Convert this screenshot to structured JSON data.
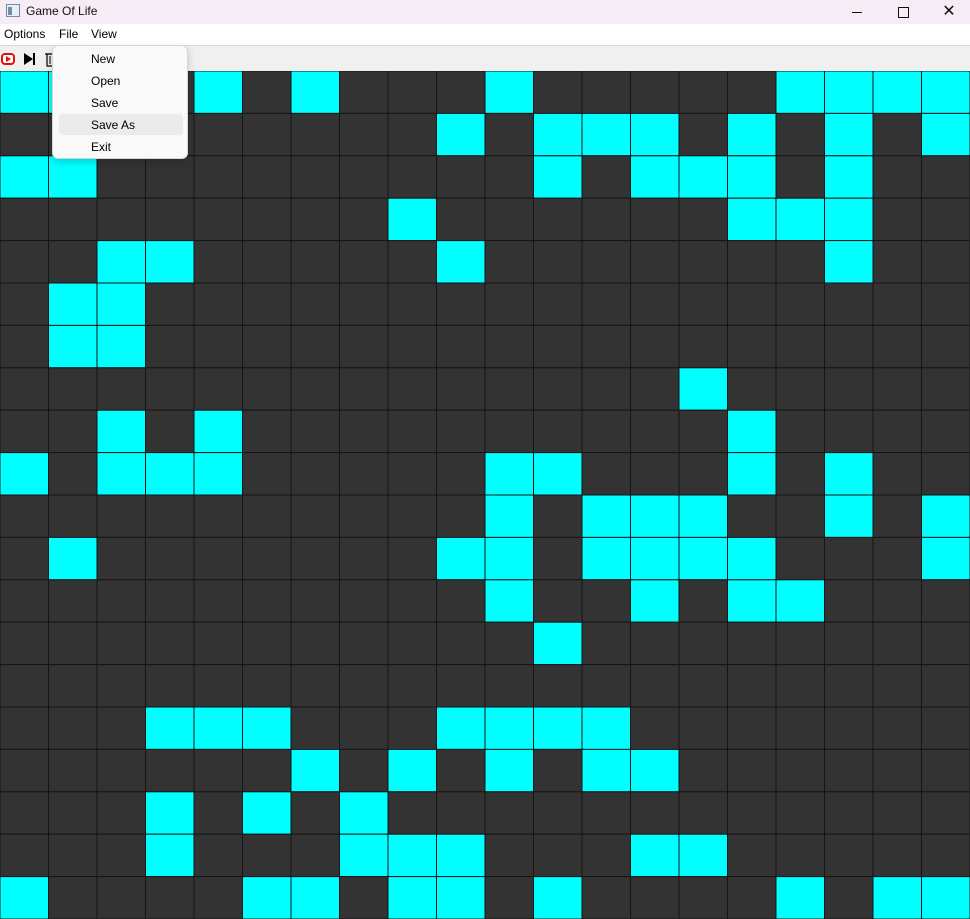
{
  "window": {
    "title": "Game Of Life",
    "icon": "app-window-icon",
    "controls": {
      "minimize": "minimize-icon",
      "maximize": "maximize-icon",
      "close": "close-icon",
      "close_glyph": "✕"
    }
  },
  "menubar": {
    "options_label": "Options",
    "file_label": "File",
    "view_label": "View"
  },
  "toolbar": {
    "buttons": [
      "play-icon",
      "step-icon",
      "clear-icon"
    ]
  },
  "file_menu": {
    "items": [
      {
        "label": "New",
        "highlighted": false
      },
      {
        "label": "Open",
        "highlighted": false
      },
      {
        "label": "Save",
        "highlighted": false
      },
      {
        "label": "Save As",
        "highlighted": true
      },
      {
        "label": "Exit",
        "highlighted": false
      }
    ]
  },
  "colors": {
    "alive": "#00ffff",
    "dead": "#333333",
    "grid_line": "#151515",
    "play_icon": "#e01010"
  },
  "grid": {
    "rows": 20,
    "cols": 20,
    "cells": [
      "11001010001000001111",
      "00000000010111010101",
      "11000000000101110100",
      "00000000100000011100",
      "00110000010000000100",
      "01100000000000000000",
      "01100000000000000000",
      "00000000000000100000",
      "00101000000000010000",
      "10111000001100010100",
      "00000000001011100101",
      "01000000011011110001",
      "00000000001001011000",
      "00000000000100000000",
      "00000000000000000000",
      "00011100011110000000",
      "00000010101011000000",
      "00010101000000000000",
      "00010001110001100000",
      "10000110110100001011"
    ]
  }
}
